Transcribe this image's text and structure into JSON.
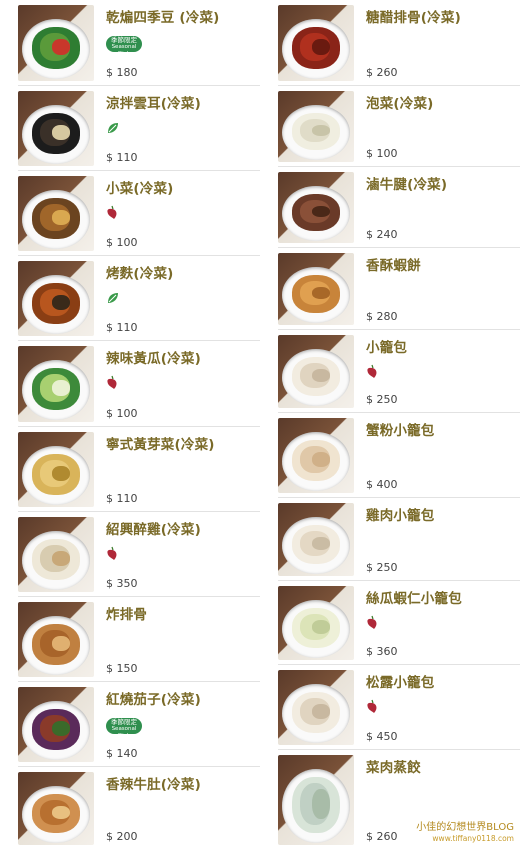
{
  "left_items": [
    {
      "name": "乾煸四季豆 (冷菜)",
      "badge": "seasonal",
      "price": "$ 180",
      "colors": [
        "#2e7d32",
        "#5a9a3a",
        "#c8372b"
      ]
    },
    {
      "name": "涼拌雲耳(冷菜)",
      "badge": "leaf",
      "price": "$ 110",
      "colors": [
        "#1c1c1c",
        "#3a3028",
        "#d6c8a0"
      ]
    },
    {
      "name": "小菜(冷菜)",
      "badge": "chili",
      "price": "$ 100",
      "colors": [
        "#6b4420",
        "#a0662a",
        "#d9a850"
      ]
    },
    {
      "name": "烤麩(冷菜)",
      "badge": "leaf",
      "price": "$ 110",
      "colors": [
        "#8a3e14",
        "#b8561e",
        "#3a2a1a"
      ]
    },
    {
      "name": "辣味黃瓜(冷菜)",
      "badge": "chili",
      "price": "$ 100",
      "colors": [
        "#3d8a3a",
        "#a8d070",
        "#e8f0d0"
      ]
    },
    {
      "name": "寧式黃芽菜(冷菜)",
      "badge": "none",
      "price": "$ 110",
      "colors": [
        "#d9b45a",
        "#e8c978",
        "#b08a30"
      ]
    },
    {
      "name": "紹興醉雞(冷菜)",
      "badge": "chili",
      "price": "$ 350",
      "colors": [
        "#eee8d8",
        "#d8ccb0",
        "#c8a878"
      ]
    },
    {
      "name": "炸排骨",
      "badge": "none",
      "price": "$ 150",
      "colors": [
        "#c08040",
        "#a8642a",
        "#e0b070"
      ]
    },
    {
      "name": "紅燒茄子(冷菜)",
      "badge": "seasonal",
      "price": "$ 140",
      "colors": [
        "#5a2a5a",
        "#8a3a2a",
        "#3a6a2a"
      ]
    },
    {
      "name": "香辣牛肚(冷菜)",
      "badge": "none",
      "price": "$ 200",
      "colors": [
        "#d09050",
        "#b87030",
        "#e8c080"
      ]
    }
  ],
  "right_items": [
    {
      "name": "糖醋排骨(冷菜)",
      "badge": "none",
      "price": "$ 260",
      "colors": [
        "#8a2418",
        "#b0301e",
        "#6a1a10"
      ]
    },
    {
      "name": "泡菜(冷菜)",
      "badge": "none",
      "price": "$ 100",
      "colors": [
        "#f0eee0",
        "#e0dcc8",
        "#c8c4a8"
      ]
    },
    {
      "name": "滷牛腱(冷菜)",
      "badge": "none",
      "price": "$ 240",
      "colors": [
        "#6a3a28",
        "#8a5038",
        "#4a2818"
      ]
    },
    {
      "name": "香酥蝦餅",
      "badge": "none",
      "price": "$ 280",
      "colors": [
        "#c8843a",
        "#e0a050",
        "#a86828"
      ]
    },
    {
      "name": "小籠包",
      "badge": "chili",
      "price": "$ 250",
      "colors": [
        "#f2ece0",
        "#e0d4c0",
        "#c8b8a0"
      ]
    },
    {
      "name": "蟹粉小籠包",
      "badge": "none",
      "price": "$ 400",
      "colors": [
        "#f0e4d0",
        "#e0c8a8",
        "#d0b088"
      ]
    },
    {
      "name": "雞肉小籠包",
      "badge": "none",
      "price": "$ 250",
      "colors": [
        "#f2ece0",
        "#e4d8c4",
        "#cabca4"
      ]
    },
    {
      "name": "絲瓜蝦仁小籠包",
      "badge": "chili",
      "price": "$ 360",
      "colors": [
        "#eef0d8",
        "#dce4b8",
        "#c0cc98"
      ]
    },
    {
      "name": "松露小籠包",
      "badge": "chili",
      "price": "$ 450",
      "colors": [
        "#f2ece0",
        "#e0d4c0",
        "#c8b8a0"
      ]
    },
    {
      "name": "菜肉蒸餃",
      "badge": "none",
      "price": "$ 260",
      "colors": [
        "#d8e4d8",
        "#c0d0c4",
        "#a8bca8"
      ]
    }
  ],
  "badge_text": {
    "seasonal_cn": "季節限定",
    "seasonal_en": "Seasonal Dish"
  },
  "watermark": {
    "title": "小佳的幻想世界BLOG",
    "url": "www.tiffany0118.com"
  },
  "theme": {
    "name_color": "#7a6a28",
    "chili_color": "#b02838",
    "leaf_color": "#3a9a4a",
    "seasonal_color": "#2f8f4e"
  }
}
